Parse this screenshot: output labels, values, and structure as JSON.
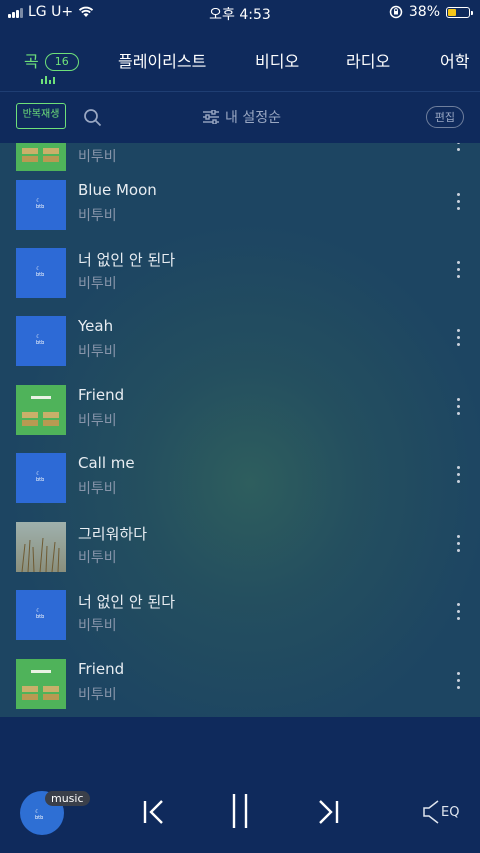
{
  "status": {
    "carrier": "LG U+",
    "time": "오후 4:53",
    "battery": "38%"
  },
  "tabs": [
    {
      "label": "곡",
      "count": "16"
    },
    {
      "label": "플레이리스트"
    },
    {
      "label": "비디오"
    },
    {
      "label": "라디오"
    },
    {
      "label": "어학"
    }
  ],
  "toolbar": {
    "repeat_label": "반복재생",
    "sort_label": "내 설정순",
    "edit_label": "편집"
  },
  "songs": [
    {
      "title": "",
      "artist": "비투비",
      "art": "friend"
    },
    {
      "title": "Blue Moon",
      "artist": "비투비",
      "art": "blue"
    },
    {
      "title": "너 없인 안 된다",
      "artist": "비투비",
      "art": "blue"
    },
    {
      "title": "Yeah",
      "artist": "비투비",
      "art": "blue"
    },
    {
      "title": "Friend",
      "artist": "비투비",
      "art": "friend"
    },
    {
      "title": "Call me",
      "artist": "비투비",
      "art": "blue"
    },
    {
      "title": "그리워하다",
      "artist": "비투비",
      "art": "reeds"
    },
    {
      "title": "너 없인 안 된다",
      "artist": "비투비",
      "art": "blue"
    },
    {
      "title": "Friend",
      "artist": "비투비",
      "art": "friend"
    }
  ],
  "player": {
    "badge": "music",
    "eq_label": "EQ"
  },
  "colors": {
    "background": "#0f2a5c",
    "accent": "#6ee07a"
  }
}
